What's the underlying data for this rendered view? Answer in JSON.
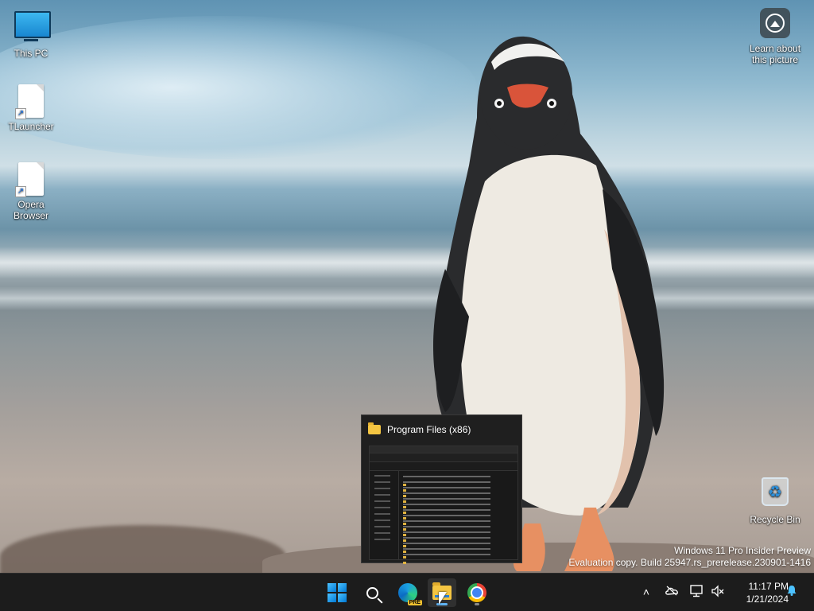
{
  "desktop": {
    "icons": [
      {
        "label": "This PC"
      },
      {
        "label": "TLauncher"
      },
      {
        "label": "Opera Browser"
      },
      {
        "label": "Learn about this picture"
      },
      {
        "label": "Recycle Bin"
      }
    ],
    "watermark": {
      "line1": "Windows 11 Pro Insider Preview",
      "line2": "Evaluation copy. Build 25947.rs_prerelease.230901-1416"
    }
  },
  "preview": {
    "title": "Program Files (x86)",
    "icon": "folder-icon"
  },
  "taskbar": {
    "apps": [
      {
        "name": "Start",
        "icon": "windows-logo-icon"
      },
      {
        "name": "Search",
        "icon": "search-icon"
      },
      {
        "name": "Microsoft Edge Canary",
        "icon": "edge-icon",
        "badge": "PRE"
      },
      {
        "name": "File Explorer",
        "icon": "folder-icon"
      },
      {
        "name": "Google Chrome",
        "icon": "chrome-icon"
      }
    ],
    "tray": {
      "icons": [
        "chevron-up-icon",
        "onedrive-icon",
        "network-icon",
        "volume-muted-icon",
        "notification-bell-icon"
      ],
      "time": "11:17 PM",
      "date": "1/21/2024"
    }
  },
  "colors": {
    "taskbar_bg": "#1c1c1c",
    "accent": "#0078d4",
    "folder_yellow": "#f4c542"
  }
}
